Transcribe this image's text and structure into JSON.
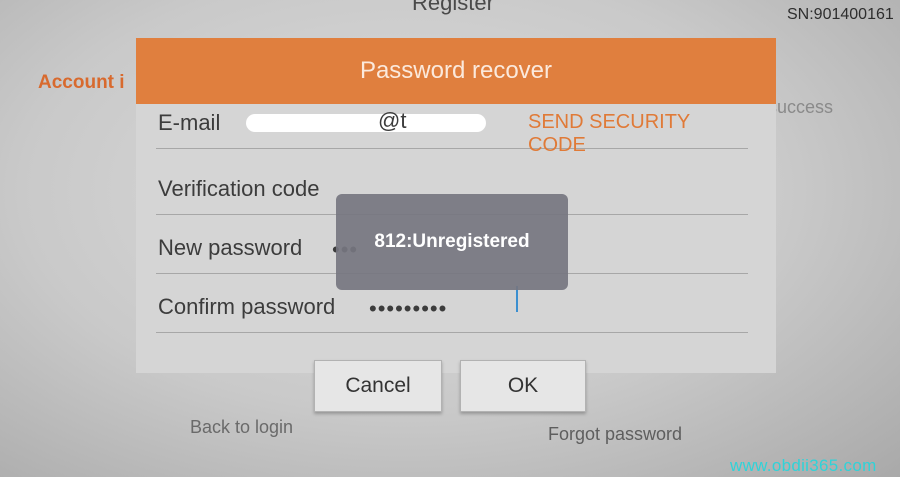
{
  "background": {
    "title": "Register",
    "serial": "SN:901400161",
    "account_label": "Account i",
    "success_text": "success",
    "back_to_login": "Back to login",
    "forgot_password": "Forgot password"
  },
  "dialog": {
    "title": "Password recover",
    "email": {
      "label": "E-mail",
      "value_visible": "@t",
      "send_code_label": "SEND SECURITY CODE"
    },
    "verification": {
      "label": "Verification code"
    },
    "new_password": {
      "label": "New password",
      "masked_value": "•••"
    },
    "confirm_password": {
      "label": "Confirm password",
      "masked_value": "•••••••••"
    },
    "cancel_label": "Cancel",
    "ok_label": "OK"
  },
  "toast": {
    "message": "812:Unregistered"
  },
  "watermark": "www.obdii365.com",
  "colors": {
    "header_orange": "#e07f3e",
    "accent_orange": "#e07a37",
    "toast_bg": "#767680",
    "watermark": "#2fd3d8"
  }
}
